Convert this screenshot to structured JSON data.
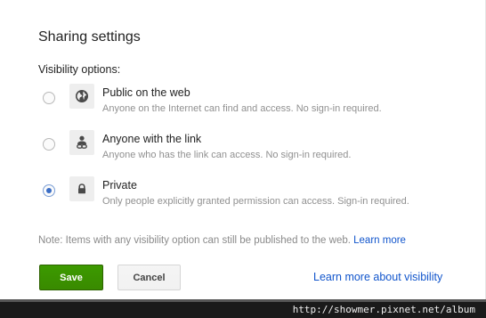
{
  "dialog": {
    "title": "Sharing settings",
    "visibility_label": "Visibility options:"
  },
  "options": [
    {
      "title": "Public on the web",
      "description": "Anyone on the Internet can find and access. No sign-in required.",
      "icon": "globe-icon",
      "selected": false
    },
    {
      "title": "Anyone with the link",
      "description": "Anyone who has the link can access. No sign-in required.",
      "icon": "person-link-icon",
      "selected": false
    },
    {
      "title": "Private",
      "description": "Only people explicitly granted permission can access. Sign-in required.",
      "icon": "lock-icon",
      "selected": true
    }
  ],
  "note": {
    "text": "Note: Items with any visibility option can still be published to the web.",
    "link": "Learn more"
  },
  "buttons": {
    "save": "Save",
    "cancel": "Cancel"
  },
  "learn_more_visibility": "Learn more about visibility",
  "watermark": "http://showmer.pixnet.net/album",
  "colors": {
    "save_button": "#3d9400",
    "link": "#1155cc",
    "radio_selected": "#3a6dc5"
  }
}
